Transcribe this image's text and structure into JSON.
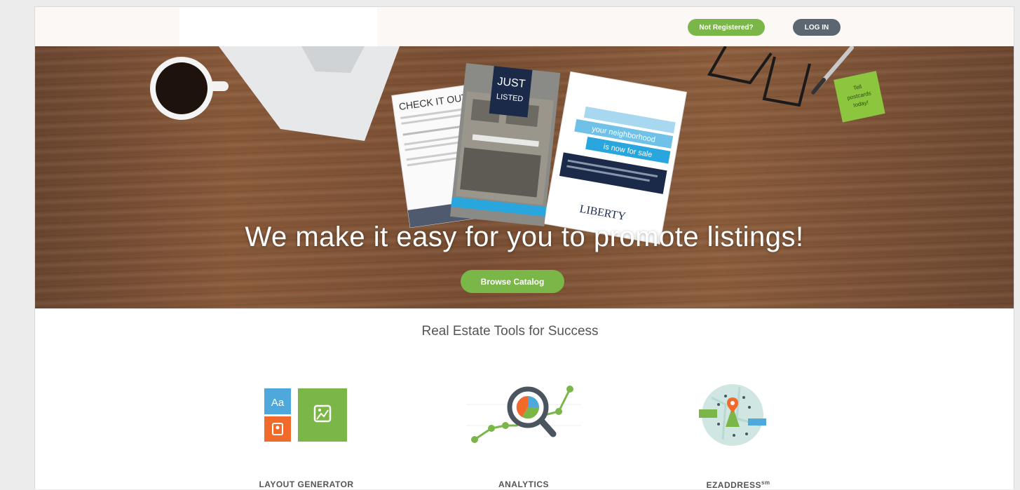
{
  "header": {
    "not_registered_label": "Not Registered?",
    "login_label": "LOG IN"
  },
  "hero": {
    "title": "We make it easy for you to promote listings!",
    "browse_label": "Browse Catalog",
    "card_check_it_out": "CHECK IT OUT",
    "card_just": "JUST",
    "card_listed": "LISTED",
    "card_brand": "LIBERTY",
    "card_line1": "your neighborhood",
    "card_line2": "is now for sale",
    "sticky_note": "Tell postcards today!"
  },
  "section": {
    "title": "Real Estate Tools for Success"
  },
  "features": [
    {
      "label": "LAYOUT GENERATOR",
      "icon": "layout-generator-icon"
    },
    {
      "label": "ANALYTICS",
      "icon": "analytics-icon"
    },
    {
      "label": "EZADDRESS",
      "superscript": "sm",
      "icon": "ezaddress-map-icon"
    }
  ],
  "colors": {
    "green": "#7ab648",
    "dark_pill": "#5b6670",
    "blue": "#4fa8dc",
    "orange": "#f26a2a",
    "navy": "#1c2a4a"
  }
}
